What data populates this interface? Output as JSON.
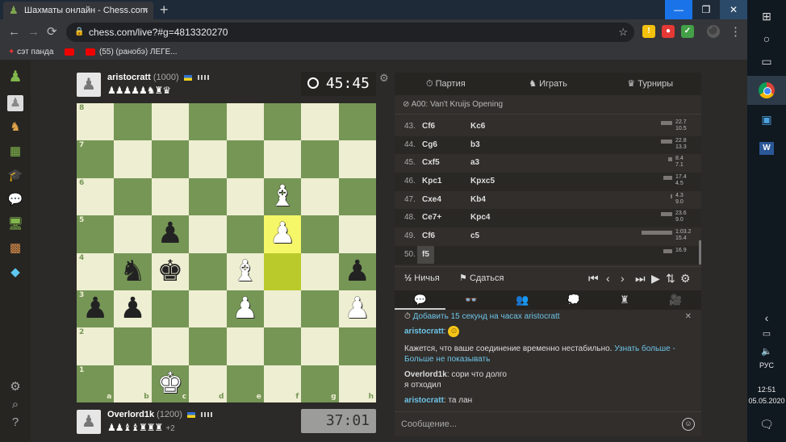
{
  "browser": {
    "tab_title": "Шахматы онлайн - Chess.com",
    "tab_close": "×",
    "new_tab": "+",
    "url": "chess.com/live?#g=4813320270",
    "window_controls": {
      "minimize": "—",
      "maximize": "❐",
      "close": "✕"
    },
    "nav": {
      "back": "←",
      "forward": "→",
      "reload": "⟳"
    },
    "star": "☆",
    "extensions": [
      {
        "label": "!",
        "color": "#f4c20d"
      },
      {
        "label": "●",
        "color": "#e53935"
      },
      {
        "label": "✓",
        "color": "#43a047"
      },
      {
        "label": "⚫",
        "color": "#5a5a5a"
      }
    ],
    "menu": "⋮",
    "bookmarks": [
      "сэт панда",
      "",
      "(55) (ранобэ) ЛЕГЕ..."
    ]
  },
  "game": {
    "top_player": {
      "name": "aristocratt",
      "rating": "(1000)",
      "captured": "♟♟♟♟♟♞♜♛",
      "clock": "45:45"
    },
    "bottom_player": {
      "name": "Overlord1k",
      "rating": "(1200)",
      "captured": "♟♟♝♝♜♜♜",
      "advantage": "+2",
      "clock": "37:01"
    },
    "file_labels": [
      "a",
      "b",
      "c",
      "d",
      "e",
      "f",
      "g",
      "h"
    ],
    "rank_labels": [
      "8",
      "7",
      "6",
      "5",
      "4",
      "3",
      "2",
      "1"
    ],
    "board": [
      [
        "",
        "",
        "",
        "",
        "",
        "",
        "",
        ""
      ],
      [
        "",
        "",
        "",
        "",
        "",
        "",
        "",
        ""
      ],
      [
        "",
        "",
        "",
        "",
        "",
        "B",
        "",
        ""
      ],
      [
        "",
        "",
        "p",
        "",
        "",
        "P",
        "",
        ""
      ],
      [
        "",
        "n",
        "k",
        "",
        "B",
        "",
        "",
        "p"
      ],
      [
        "p",
        "p",
        "",
        "",
        "P",
        "",
        "",
        "P"
      ],
      [
        "",
        "",
        "",
        "",
        "",
        "",
        "",
        ""
      ],
      [
        "",
        "",
        "K",
        "",
        "",
        "",
        "",
        ""
      ]
    ],
    "highlights": [
      "f5",
      "f4"
    ]
  },
  "panel": {
    "tabs": [
      {
        "icon": "⏱",
        "label": "Партия"
      },
      {
        "icon": "♞",
        "label": "Играть"
      },
      {
        "icon": "♛",
        "label": "Турниры"
      }
    ],
    "opening": "A00: Van't Kruijs Opening",
    "moves": [
      {
        "num": "43.",
        "white": "Cf6",
        "black": "Kc6",
        "t1": "22.7",
        "t2": "10.5",
        "bar": 0.12
      },
      {
        "num": "44.",
        "white": "Cg6",
        "black": "b3",
        "t1": "22.8",
        "t2": "13.3",
        "bar": 0.12
      },
      {
        "num": "45.",
        "white": "Cxf5",
        "black": "a3",
        "t1": "8.4",
        "t2": "7.1",
        "bar": 0.04
      },
      {
        "num": "46.",
        "white": "Kpc1",
        "black": "Kpxc5",
        "t1": "17.4",
        "t2": "4.5",
        "bar": 0.09
      },
      {
        "num": "47.",
        "white": "Cxe4",
        "black": "Kb4",
        "t1": "4.3",
        "t2": "9.0",
        "bar": 0.02
      },
      {
        "num": "48.",
        "white": "Ce7+",
        "black": "Kpc4",
        "t1": "23.6",
        "t2": "9.0",
        "bar": 0.12
      },
      {
        "num": "49.",
        "white": "Cf6",
        "black": "c5",
        "t1": "1:03.2",
        "t2": "15.4",
        "bar": 0.32
      },
      {
        "num": "50.",
        "white": "f5",
        "black": "",
        "t1": "16.9",
        "t2": "",
        "bar": 0.09
      }
    ],
    "draw_icon": "½",
    "draw_label": "Ничья",
    "resign_icon": "⚑",
    "resign_label": "Сдаться",
    "controls": [
      "⏮",
      "‹",
      "›",
      "⏭",
      "▶",
      "⇅",
      "⚙"
    ],
    "chat_tabs": [
      "💬",
      "👓",
      "👥",
      "💭",
      "♜",
      "🎥"
    ],
    "chat": {
      "time_notice": "Добавить 15 секунд на часах aristocratt",
      "msg1_user": "aristocratt",
      "msg1_text": "☺",
      "connection_warning": "Кажется, что ваше соединение временно нестабильно.",
      "learn_more": "Узнать больше",
      "dont_show": "- Больше не показывать",
      "msg2_user": "Overlord1k",
      "msg2_text": "сори что долго",
      "msg2_text2": "я отходил",
      "msg3_user": "aristocratt",
      "msg3_text": "та лан",
      "input_placeholder": "Сообщение..."
    }
  },
  "taskbar": {
    "lang": "РУС",
    "time": "12:51",
    "date": "05.05.2020"
  }
}
